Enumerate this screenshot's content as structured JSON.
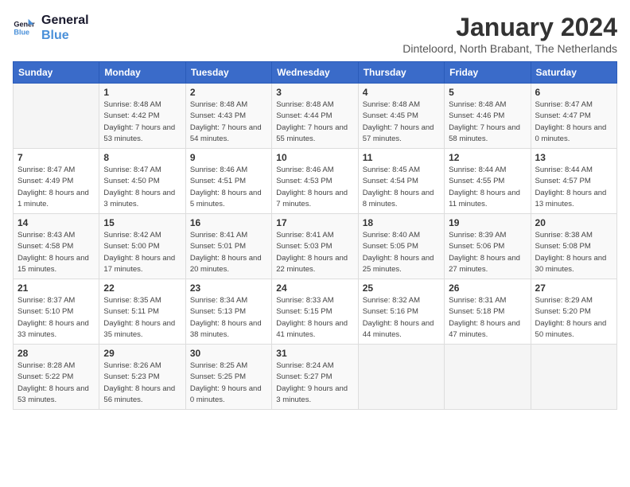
{
  "header": {
    "logo_line1": "General",
    "logo_line2": "Blue",
    "month_title": "January 2024",
    "location": "Dinteloord, North Brabant, The Netherlands"
  },
  "weekdays": [
    "Sunday",
    "Monday",
    "Tuesday",
    "Wednesday",
    "Thursday",
    "Friday",
    "Saturday"
  ],
  "weeks": [
    [
      {
        "day": "",
        "sunrise": "",
        "sunset": "",
        "daylight": ""
      },
      {
        "day": "1",
        "sunrise": "Sunrise: 8:48 AM",
        "sunset": "Sunset: 4:42 PM",
        "daylight": "Daylight: 7 hours and 53 minutes."
      },
      {
        "day": "2",
        "sunrise": "Sunrise: 8:48 AM",
        "sunset": "Sunset: 4:43 PM",
        "daylight": "Daylight: 7 hours and 54 minutes."
      },
      {
        "day": "3",
        "sunrise": "Sunrise: 8:48 AM",
        "sunset": "Sunset: 4:44 PM",
        "daylight": "Daylight: 7 hours and 55 minutes."
      },
      {
        "day": "4",
        "sunrise": "Sunrise: 8:48 AM",
        "sunset": "Sunset: 4:45 PM",
        "daylight": "Daylight: 7 hours and 57 minutes."
      },
      {
        "day": "5",
        "sunrise": "Sunrise: 8:48 AM",
        "sunset": "Sunset: 4:46 PM",
        "daylight": "Daylight: 7 hours and 58 minutes."
      },
      {
        "day": "6",
        "sunrise": "Sunrise: 8:47 AM",
        "sunset": "Sunset: 4:47 PM",
        "daylight": "Daylight: 8 hours and 0 minutes."
      }
    ],
    [
      {
        "day": "7",
        "sunrise": "Sunrise: 8:47 AM",
        "sunset": "Sunset: 4:49 PM",
        "daylight": "Daylight: 8 hours and 1 minute."
      },
      {
        "day": "8",
        "sunrise": "Sunrise: 8:47 AM",
        "sunset": "Sunset: 4:50 PM",
        "daylight": "Daylight: 8 hours and 3 minutes."
      },
      {
        "day": "9",
        "sunrise": "Sunrise: 8:46 AM",
        "sunset": "Sunset: 4:51 PM",
        "daylight": "Daylight: 8 hours and 5 minutes."
      },
      {
        "day": "10",
        "sunrise": "Sunrise: 8:46 AM",
        "sunset": "Sunset: 4:53 PM",
        "daylight": "Daylight: 8 hours and 7 minutes."
      },
      {
        "day": "11",
        "sunrise": "Sunrise: 8:45 AM",
        "sunset": "Sunset: 4:54 PM",
        "daylight": "Daylight: 8 hours and 8 minutes."
      },
      {
        "day": "12",
        "sunrise": "Sunrise: 8:44 AM",
        "sunset": "Sunset: 4:55 PM",
        "daylight": "Daylight: 8 hours and 11 minutes."
      },
      {
        "day": "13",
        "sunrise": "Sunrise: 8:44 AM",
        "sunset": "Sunset: 4:57 PM",
        "daylight": "Daylight: 8 hours and 13 minutes."
      }
    ],
    [
      {
        "day": "14",
        "sunrise": "Sunrise: 8:43 AM",
        "sunset": "Sunset: 4:58 PM",
        "daylight": "Daylight: 8 hours and 15 minutes."
      },
      {
        "day": "15",
        "sunrise": "Sunrise: 8:42 AM",
        "sunset": "Sunset: 5:00 PM",
        "daylight": "Daylight: 8 hours and 17 minutes."
      },
      {
        "day": "16",
        "sunrise": "Sunrise: 8:41 AM",
        "sunset": "Sunset: 5:01 PM",
        "daylight": "Daylight: 8 hours and 20 minutes."
      },
      {
        "day": "17",
        "sunrise": "Sunrise: 8:41 AM",
        "sunset": "Sunset: 5:03 PM",
        "daylight": "Daylight: 8 hours and 22 minutes."
      },
      {
        "day": "18",
        "sunrise": "Sunrise: 8:40 AM",
        "sunset": "Sunset: 5:05 PM",
        "daylight": "Daylight: 8 hours and 25 minutes."
      },
      {
        "day": "19",
        "sunrise": "Sunrise: 8:39 AM",
        "sunset": "Sunset: 5:06 PM",
        "daylight": "Daylight: 8 hours and 27 minutes."
      },
      {
        "day": "20",
        "sunrise": "Sunrise: 8:38 AM",
        "sunset": "Sunset: 5:08 PM",
        "daylight": "Daylight: 8 hours and 30 minutes."
      }
    ],
    [
      {
        "day": "21",
        "sunrise": "Sunrise: 8:37 AM",
        "sunset": "Sunset: 5:10 PM",
        "daylight": "Daylight: 8 hours and 33 minutes."
      },
      {
        "day": "22",
        "sunrise": "Sunrise: 8:35 AM",
        "sunset": "Sunset: 5:11 PM",
        "daylight": "Daylight: 8 hours and 35 minutes."
      },
      {
        "day": "23",
        "sunrise": "Sunrise: 8:34 AM",
        "sunset": "Sunset: 5:13 PM",
        "daylight": "Daylight: 8 hours and 38 minutes."
      },
      {
        "day": "24",
        "sunrise": "Sunrise: 8:33 AM",
        "sunset": "Sunset: 5:15 PM",
        "daylight": "Daylight: 8 hours and 41 minutes."
      },
      {
        "day": "25",
        "sunrise": "Sunrise: 8:32 AM",
        "sunset": "Sunset: 5:16 PM",
        "daylight": "Daylight: 8 hours and 44 minutes."
      },
      {
        "day": "26",
        "sunrise": "Sunrise: 8:31 AM",
        "sunset": "Sunset: 5:18 PM",
        "daylight": "Daylight: 8 hours and 47 minutes."
      },
      {
        "day": "27",
        "sunrise": "Sunrise: 8:29 AM",
        "sunset": "Sunset: 5:20 PM",
        "daylight": "Daylight: 8 hours and 50 minutes."
      }
    ],
    [
      {
        "day": "28",
        "sunrise": "Sunrise: 8:28 AM",
        "sunset": "Sunset: 5:22 PM",
        "daylight": "Daylight: 8 hours and 53 minutes."
      },
      {
        "day": "29",
        "sunrise": "Sunrise: 8:26 AM",
        "sunset": "Sunset: 5:23 PM",
        "daylight": "Daylight: 8 hours and 56 minutes."
      },
      {
        "day": "30",
        "sunrise": "Sunrise: 8:25 AM",
        "sunset": "Sunset: 5:25 PM",
        "daylight": "Daylight: 9 hours and 0 minutes."
      },
      {
        "day": "31",
        "sunrise": "Sunrise: 8:24 AM",
        "sunset": "Sunset: 5:27 PM",
        "daylight": "Daylight: 9 hours and 3 minutes."
      },
      {
        "day": "",
        "sunrise": "",
        "sunset": "",
        "daylight": ""
      },
      {
        "day": "",
        "sunrise": "",
        "sunset": "",
        "daylight": ""
      },
      {
        "day": "",
        "sunrise": "",
        "sunset": "",
        "daylight": ""
      }
    ]
  ]
}
